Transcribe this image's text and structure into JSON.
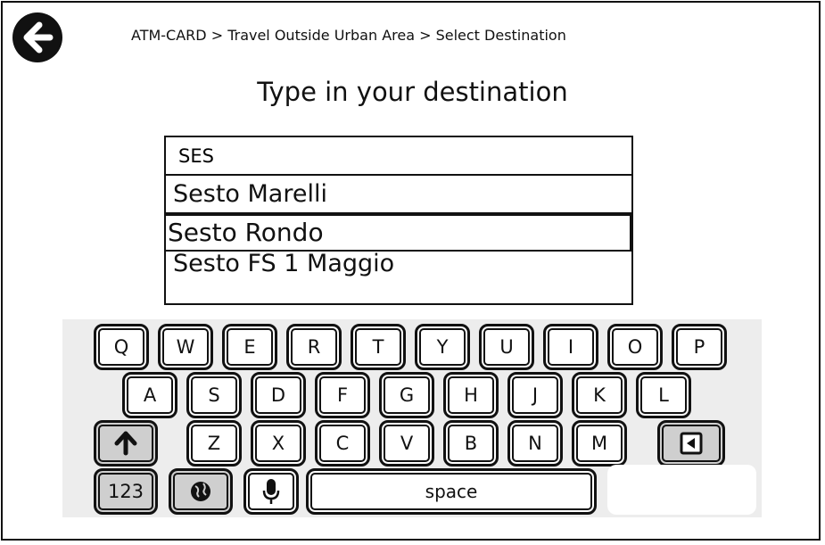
{
  "header": {
    "back_icon": "arrow-left-circle-icon",
    "breadcrumb": "ATM-CARD > Travel Outside Urban Area > Select Destination"
  },
  "main": {
    "title": "Type in your destination",
    "search": {
      "value": "SES"
    },
    "suggestions": [
      "Sesto Marelli",
      "Sesto Rondo",
      "Sesto FS 1 Maggio"
    ]
  },
  "keyboard": {
    "row1": [
      "Q",
      "W",
      "E",
      "R",
      "T",
      "Y",
      "U",
      "I",
      "O",
      "P"
    ],
    "row2": [
      "A",
      "S",
      "D",
      "F",
      "G",
      "H",
      "J",
      "K",
      "L"
    ],
    "row3": [
      "Z",
      "X",
      "C",
      "V",
      "B",
      "N",
      "M"
    ],
    "shift_icon": "arrow-up-icon",
    "backspace_icon": "backspace-icon",
    "numbers_label": "123",
    "globe_icon": "globe-icon",
    "mic_icon": "microphone-icon",
    "space_label": "space"
  }
}
